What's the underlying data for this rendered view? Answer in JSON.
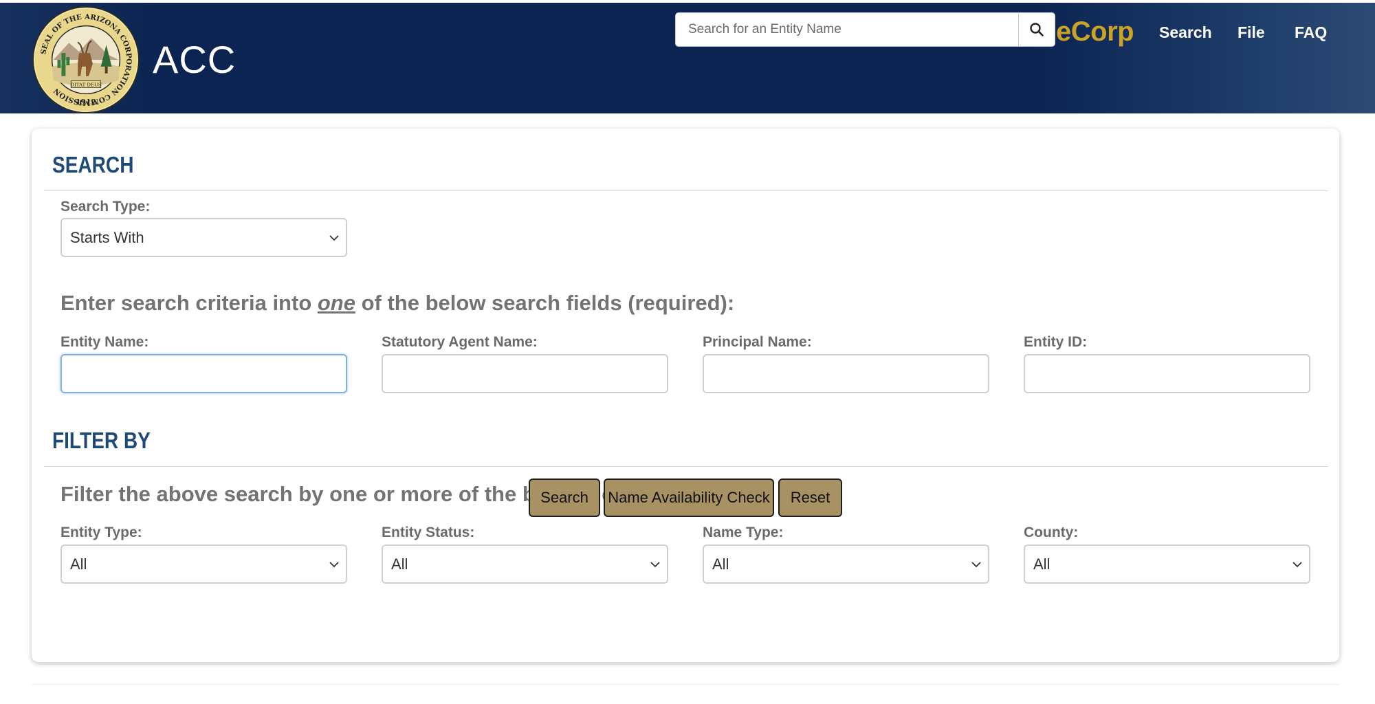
{
  "header": {
    "brand": "ACC",
    "seal_text_outer": "SEAL OF THE ARIZONA CORPORATION COMMISSION",
    "seal_motto": "DITAT DEUS",
    "seal_year": "1912",
    "search_placeholder": "Search for an Entity Name",
    "ecorp": "eCorp",
    "nav": [
      "Search",
      "File",
      "FAQ"
    ],
    "colors": {
      "bar": "#0b2452",
      "ecorp": "#c9a227"
    }
  },
  "search_section": {
    "title": "SEARCH",
    "search_type_label": "Search Type:",
    "search_type_value": "Starts With",
    "instruction_before": "Enter search criteria into ",
    "instruction_emph": "one",
    "instruction_after": " of the below search fields (required):",
    "fields": [
      {
        "label": "Entity Name:",
        "value": ""
      },
      {
        "label": "Statutory Agent Name:",
        "value": ""
      },
      {
        "label": "Principal Name:",
        "value": ""
      },
      {
        "label": "Entity ID:",
        "value": ""
      }
    ]
  },
  "filter_section": {
    "title": "FILTER BY",
    "instruction": "Filter the above search by one or more of the below fields:",
    "filters": [
      {
        "label": "Entity Type:",
        "value": "All"
      },
      {
        "label": "Entity Status:",
        "value": "All"
      },
      {
        "label": "Name Type:",
        "value": "All"
      },
      {
        "label": "County:",
        "value": "All"
      }
    ]
  },
  "buttons": {
    "search": "Search",
    "name_check": "Name Availability Check",
    "reset": "Reset",
    "color": "#a89263"
  }
}
